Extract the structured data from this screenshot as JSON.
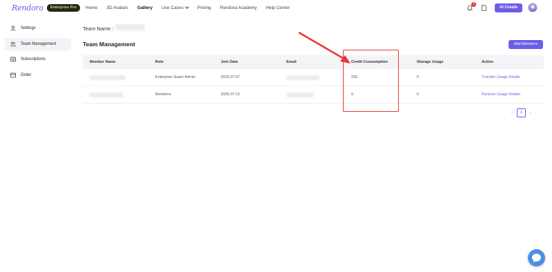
{
  "header": {
    "logo_text": "Rendora",
    "plan_badge": "Enterprise Pro",
    "nav": [
      "Home",
      "3D Avatars",
      "Gallery",
      "Use Cases",
      "Pricing",
      "Rendora Academy",
      "Help Center"
    ],
    "notification_count": "1",
    "ai_create_label": "AI Create"
  },
  "sidebar": {
    "items": [
      {
        "label": "Settings",
        "icon": "user-icon"
      },
      {
        "label": "Team Management",
        "icon": "team-icon"
      },
      {
        "label": "Subscriptions",
        "icon": "subscriptions-icon"
      },
      {
        "label": "Order",
        "icon": "order-icon"
      }
    ]
  },
  "main": {
    "team_name_label": "Team Name :",
    "section_title": "Team Management",
    "add_members_label": "Add Members",
    "columns": [
      "Member Name",
      "Role",
      "Join Date",
      "Email",
      "Credit Consumption",
      "Storage Usage",
      "Action"
    ],
    "rows": [
      {
        "role": "Enterprise Super Admin",
        "join_date": "2025.07.07",
        "credit": "226",
        "storage": "0",
        "action1": "Transfer",
        "action2": "Usage Details"
      },
      {
        "role": "Members",
        "join_date": "2025.07.16",
        "credit": "0",
        "storage": "0",
        "action1": "Remove",
        "action2": "Usage Details"
      }
    ],
    "pagination": {
      "prev": "‹",
      "current": "1",
      "next": "›"
    }
  },
  "colors": {
    "accent": "#6c5ce7",
    "annotation": "#e53935",
    "chat": "#4a90e2"
  }
}
